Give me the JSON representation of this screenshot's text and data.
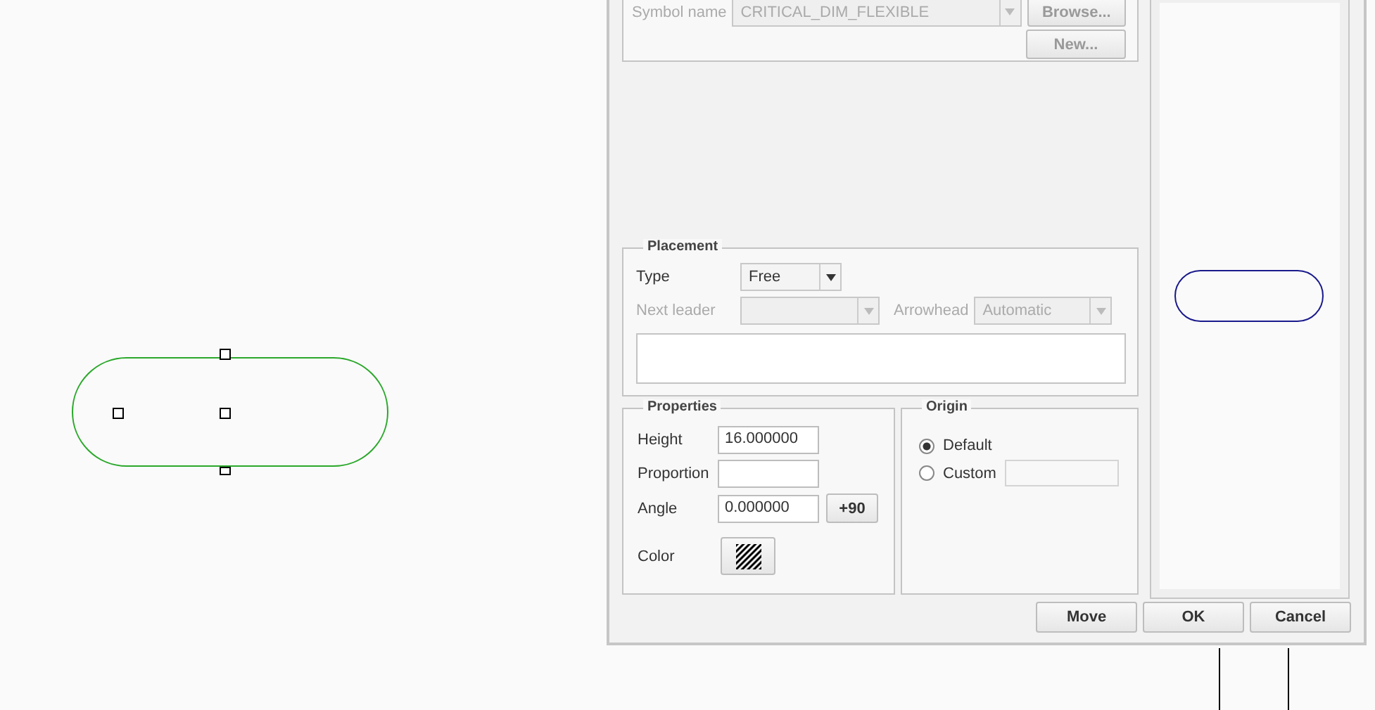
{
  "symbol": {
    "label": "Symbol name",
    "value": "CRITICAL_DIM_FLEXIBLE",
    "disabled": true,
    "browse": "Browse...",
    "new": "New..."
  },
  "placement": {
    "title": "Placement",
    "type_label": "Type",
    "type_value": "Free",
    "leader": {
      "label": "Next leader",
      "disabled": true
    },
    "arrowhead": {
      "label": "Arrowhead",
      "value": "Automatic",
      "disabled": true
    }
  },
  "properties": {
    "title": "Properties",
    "height": {
      "label": "Height",
      "value": "16.000000"
    },
    "proportion": {
      "label": "Proportion"
    },
    "angle": {
      "label": "Angle",
      "value": "0.000000",
      "button": "+90"
    },
    "color": {
      "label": "Color"
    }
  },
  "origin": {
    "title": "Origin",
    "options": [
      {
        "label": "Default",
        "selected": true
      },
      {
        "label": "Custom",
        "selected": false
      }
    ]
  },
  "buttons": [
    "Move",
    "OK",
    "Cancel"
  ]
}
